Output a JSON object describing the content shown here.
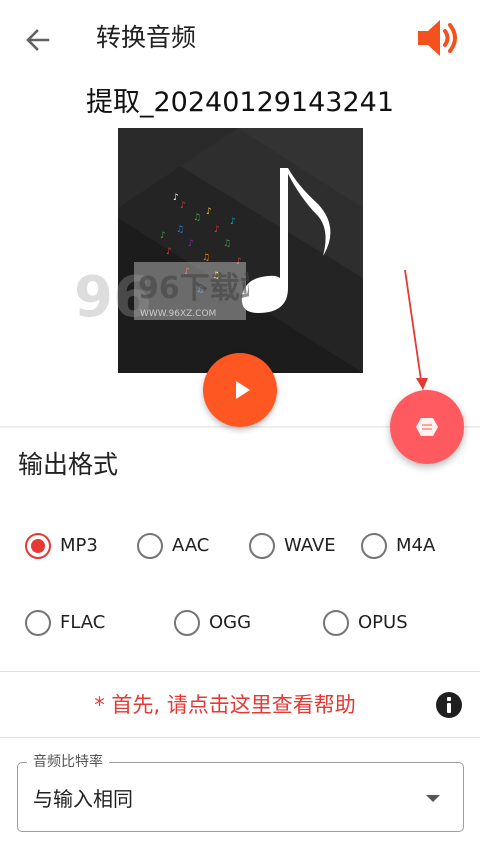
{
  "header": {
    "title": "转换音频",
    "back_icon": "arrow-left-icon",
    "speaker_icon": "volume-icon",
    "accent_color": "#f4511e"
  },
  "file": {
    "name": "提取_20240129143241"
  },
  "player": {
    "play_icon": "play-icon",
    "play_color": "#ff5722"
  },
  "fab": {
    "icon": "hexagon-icon",
    "color": "#ff5a5f"
  },
  "watermark": {
    "text": "96下载站",
    "url_text": "WWW.96XZ.COM"
  },
  "output_format": {
    "title": "输出格式",
    "options": [
      {
        "label": "MP3",
        "checked": true
      },
      {
        "label": "AAC",
        "checked": false
      },
      {
        "label": "WAVE",
        "checked": false
      },
      {
        "label": "M4A",
        "checked": false
      },
      {
        "label": "FLAC",
        "checked": false
      },
      {
        "label": "OGG",
        "checked": false
      },
      {
        "label": "OPUS",
        "checked": false
      }
    ],
    "selected_color": "#e53935"
  },
  "help": {
    "text": "* 首先, 请点击这里查看帮助",
    "icon": "info-icon",
    "color": "#e53935"
  },
  "bitrate": {
    "legend": "音频比特率",
    "value": "与输入相同",
    "caret_icon": "dropdown-arrow-icon"
  }
}
